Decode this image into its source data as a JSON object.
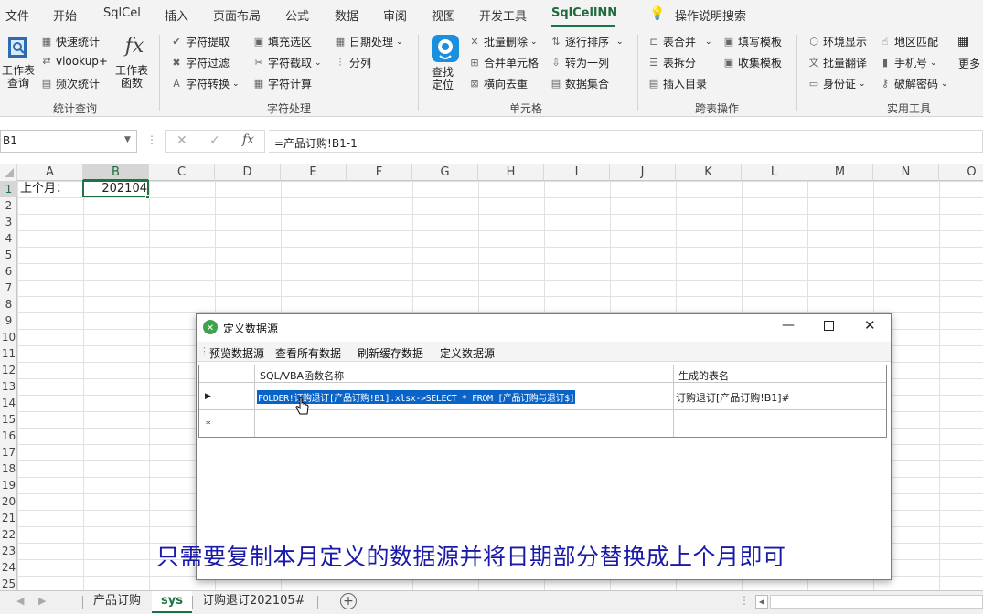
{
  "menu": [
    "文件",
    "开始",
    "SqlCel",
    "插入",
    "页面布局",
    "公式",
    "数据",
    "审阅",
    "视图",
    "开发工具",
    "SqlCellNN"
  ],
  "active_menu": "SqlCellNN",
  "search_label": "操作说明搜索",
  "ribbon": {
    "g1": {
      "big1": "工作表\n查询",
      "items": [
        "快速统计",
        "vlookup+",
        "频次统计"
      ],
      "big2": "工作表\n函数",
      "label": "统计查询"
    },
    "g2": {
      "col1": [
        "字符提取",
        "字符过滤",
        "字符转换"
      ],
      "col2": [
        "填充选区",
        "字符截取",
        "字符计算"
      ],
      "col3": [
        "日期处理",
        "分列"
      ],
      "label": "字符处理"
    },
    "g3": {
      "big": "查找\n定位",
      "col1": [
        "批量删除",
        "合并单元格",
        "横向去重"
      ],
      "col2": [
        "逐行排序",
        "转为一列",
        "数据集合"
      ],
      "label": "单元格"
    },
    "g4": {
      "col1": [
        "表合并",
        "表拆分",
        "插入目录"
      ],
      "col2": [
        "填写模板",
        "收集模板"
      ],
      "label": "跨表操作"
    },
    "g5": {
      "col1": [
        "环境显示",
        "批量翻译",
        "身份证"
      ],
      "col2": [
        "地区匹配",
        "手机号",
        "破解密码"
      ],
      "more": "更多",
      "label": "实用工具"
    }
  },
  "namebox": "B1",
  "formula": "=产品订购!B1-1",
  "columns": [
    "A",
    "B",
    "C",
    "D",
    "E",
    "F",
    "G",
    "H",
    "I",
    "J",
    "K",
    "L",
    "M",
    "N",
    "O"
  ],
  "rows": [
    "1",
    "2",
    "3",
    "4",
    "5",
    "6",
    "7",
    "8",
    "9",
    "10",
    "11",
    "12",
    "13",
    "14",
    "15",
    "16",
    "17",
    "18",
    "19",
    "20",
    "21",
    "22",
    "23",
    "24",
    "25"
  ],
  "cells": {
    "A1": "上个月：",
    "B1": "202104"
  },
  "selected_cell": "B1",
  "sheets": [
    "产品订购",
    "sys",
    "订购退订202105#"
  ],
  "active_sheet": "sys",
  "dialog": {
    "title": "定义数据源",
    "toolbar": [
      "预览数据源",
      "查看所有数据",
      "刷新缓存数据",
      "定义数据源"
    ],
    "col1_header": "SQL/VBA函数名称",
    "col2_header": "生成的表名",
    "row1_sql": "FOLDER!订购退订[产品订购!B1].xlsx->SELECT * FROM [产品订购与退订$]",
    "row1_table": "订购退订[产品订购!B1]#",
    "new_row_marker": "*"
  },
  "caption": "只需要复制本月定义的数据源并将日期部分替换成上个月即可",
  "colors": {
    "accent": "#217346",
    "caption": "#1a1aa8",
    "selection": "#0a64c8"
  }
}
